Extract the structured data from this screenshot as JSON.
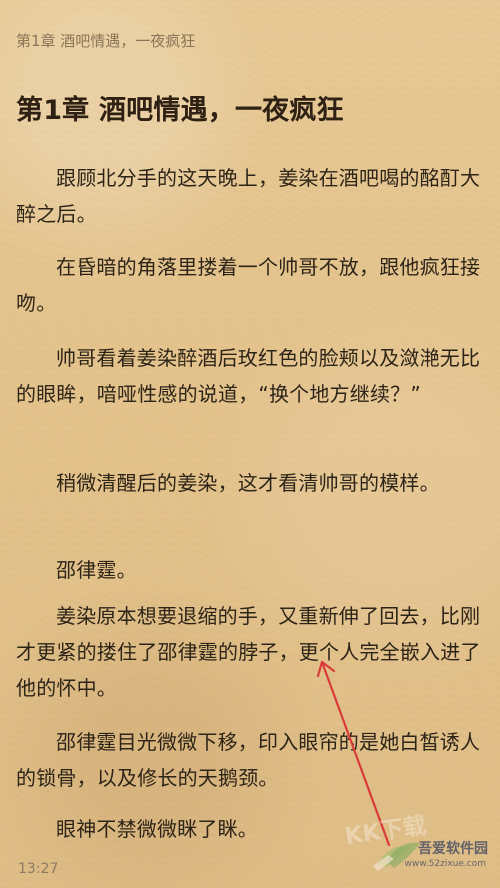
{
  "reader": {
    "running_title": "第1章 酒吧情遇，一夜疯狂",
    "chapter_title": "第1章 酒吧情遇，一夜疯狂",
    "paragraphs": [
      "跟顾北分手的这天晚上，姜染在酒吧喝的酩酊大醉之后。",
      "在昏暗的角落里搂着一个帅哥不放，跟他疯狂接吻。",
      "帅哥看着姜染醉酒后玫红色的脸颊以及潋滟无比的眼眸，喑哑性感的说道，“换个地方继续？”",
      "稍微清醒后的姜染，这才看清帅哥的模样。",
      "邵律霆。",
      "姜染原本想要退缩的手，又重新伸了回去，比刚才更紧的搂住了邵律霆的脖子，更个人完全嵌入进了他的怀中。",
      "邵律霆目光微微下移，印入眼帘的是她白皙诱人的锁骨，以及修长的天鹅颈。",
      "眼神不禁微微眯了眯。"
    ]
  },
  "status_bar": {
    "time": "13:27"
  },
  "annotation": {
    "color": "#d93a3a"
  },
  "watermark": {
    "site_name": "吾爱软件园",
    "url": "www.52zixue.com",
    "label": "KK下载"
  }
}
